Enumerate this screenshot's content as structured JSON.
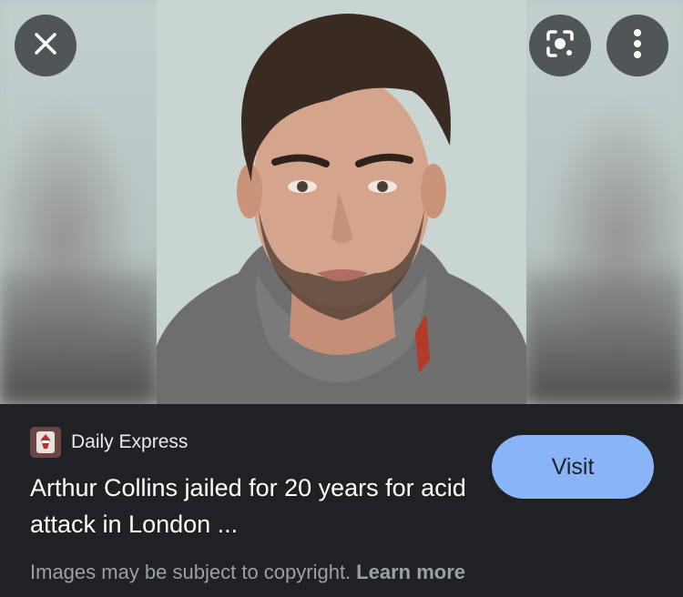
{
  "image": {
    "subject": "mugshot photo"
  },
  "overlay": {
    "close_icon": "close-icon",
    "lens_icon": "lens-icon",
    "more_icon": "more-vertical-icon"
  },
  "result": {
    "source_icon": "daily-express-favicon",
    "source_name": "Daily Express",
    "title": "Arthur Collins jailed for 20 years for acid attack in London ...",
    "visit_label": "Visit",
    "copyright_text": "Images may be subject to copyright.",
    "learn_more_label": "Learn more"
  },
  "colors": {
    "panel_bg": "#202124",
    "visit_button": "#8ab4f8",
    "overlay_button": "#3c4043"
  }
}
